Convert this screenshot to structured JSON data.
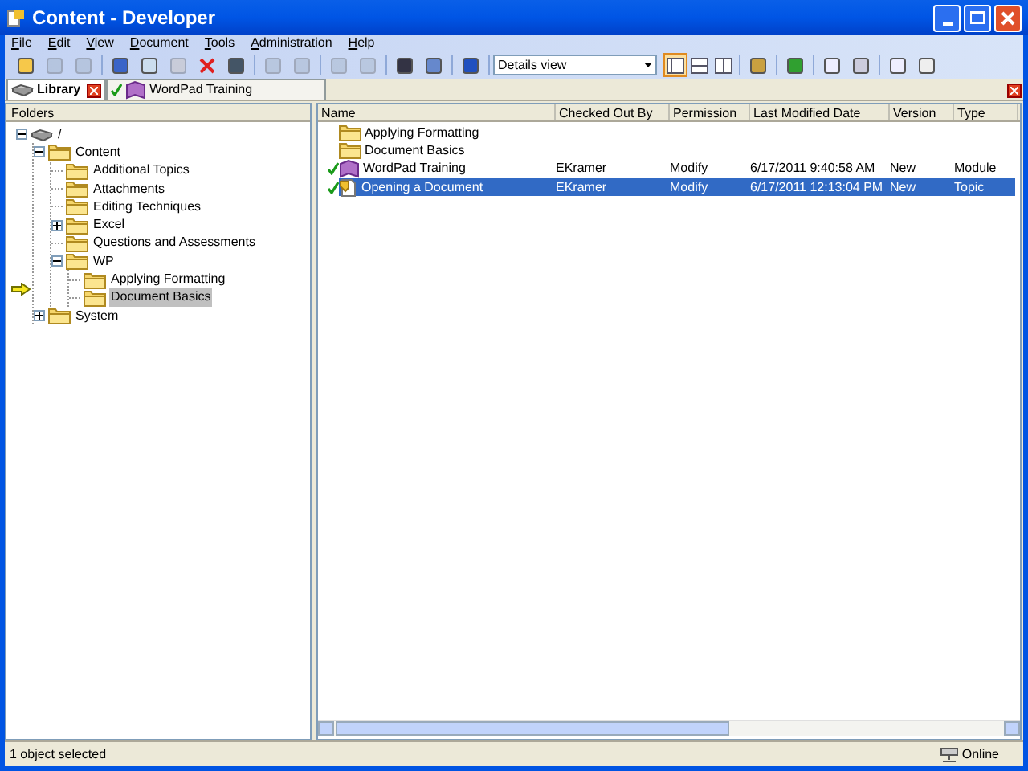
{
  "window": {
    "title": "Content - Developer"
  },
  "menu": [
    {
      "label": "File"
    },
    {
      "label": "Edit"
    },
    {
      "label": "View"
    },
    {
      "label": "Document"
    },
    {
      "label": "Tools"
    },
    {
      "label": "Administration"
    },
    {
      "label": "Help"
    }
  ],
  "toolbar": {
    "view_select": {
      "value": "Details view"
    },
    "layout_buttons": [
      {
        "selected": true
      },
      {
        "selected": false
      },
      {
        "selected": false
      }
    ]
  },
  "tabs": [
    {
      "label": "Library",
      "kind": "library",
      "selected": true
    },
    {
      "label": "WordPad Training",
      "kind": "module",
      "selected": false
    }
  ],
  "folders": {
    "header": "Folders",
    "tree": [
      {
        "label": "/",
        "kind": "drive",
        "expanded": true,
        "selected": false,
        "children": [
          {
            "label": "Content",
            "expanded": true,
            "selected": false,
            "children": [
              {
                "label": "Additional Topics",
                "selected": false
              },
              {
                "label": "Attachments",
                "selected": false
              },
              {
                "label": "Editing Techniques",
                "selected": false
              },
              {
                "label": "Excel",
                "expanded": false,
                "selected": false
              },
              {
                "label": "Questions and Assessments",
                "selected": false
              },
              {
                "label": "WP",
                "expanded": true,
                "selected": false,
                "children": [
                  {
                    "label": "Applying Formatting",
                    "selected": false
                  },
                  {
                    "label": "Document Basics",
                    "selected": true
                  }
                ]
              }
            ]
          },
          {
            "label": "System",
            "expanded": false,
            "selected": false
          }
        ]
      }
    ]
  },
  "table": {
    "columns": [
      "Name",
      "Checked Out By",
      "Permission",
      "Last Modified Date",
      "Version",
      "Type"
    ],
    "rows": [
      {
        "kind": "folder",
        "checked": false,
        "selected": false,
        "cells": [
          "Applying Formatting",
          "",
          "",
          "",
          "",
          ""
        ]
      },
      {
        "kind": "folder",
        "checked": false,
        "selected": false,
        "cells": [
          "Document Basics",
          "",
          "",
          "",
          "",
          ""
        ]
      },
      {
        "kind": "module",
        "checked": true,
        "selected": false,
        "cells": [
          "WordPad Training",
          "EKramer",
          "Modify",
          "6/17/2011 9:40:58 AM",
          "New",
          "Module"
        ]
      },
      {
        "kind": "topic",
        "checked": true,
        "selected": true,
        "cells": [
          "Opening a Document",
          "EKramer",
          "Modify",
          "6/17/2011 12:13:04 PM",
          "New",
          "Topic"
        ]
      }
    ]
  },
  "status_bar": {
    "message": "1 object selected",
    "connection": "Online"
  }
}
